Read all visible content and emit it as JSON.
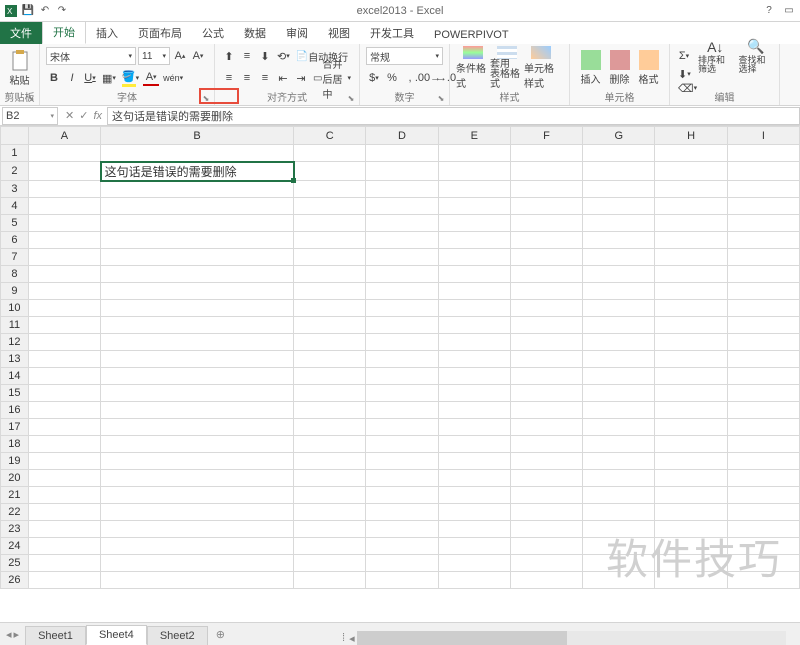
{
  "title": "excel2013 - Excel",
  "tabs": {
    "file": "文件",
    "home": "开始",
    "insert": "插入",
    "layout": "页面布局",
    "formulas": "公式",
    "data": "数据",
    "review": "审阅",
    "view": "视图",
    "dev": "开发工具",
    "pp": "POWERPIVOT"
  },
  "ribbon": {
    "clipboard": {
      "paste": "粘贴",
      "label": "剪贴板"
    },
    "font": {
      "name": "宋体",
      "size": "11",
      "label": "字体",
      "bold": "B",
      "italic": "I",
      "underline": "U"
    },
    "align": {
      "wrap": "自动换行",
      "merge": "合并后居中",
      "label": "对齐方式"
    },
    "number": {
      "general": "常规",
      "label": "数字"
    },
    "styles": {
      "cond": "条件格式",
      "table": "套用\n表格格式",
      "cell": "单元格样式",
      "label": "样式"
    },
    "cells": {
      "insert": "插入",
      "delete": "删除",
      "format": "格式",
      "label": "单元格"
    },
    "editing": {
      "sort": "排序和筛选",
      "find": "查找和选择",
      "label": "编辑"
    }
  },
  "namebox": "B2",
  "formula": "这句话是错误的需要删除",
  "columns": [
    "A",
    "B",
    "C",
    "D",
    "E",
    "F",
    "G",
    "H",
    "I"
  ],
  "rows": [
    "1",
    "2",
    "3",
    "4",
    "5",
    "6",
    "7",
    "8",
    "9",
    "10",
    "11",
    "12",
    "13",
    "14",
    "15",
    "16",
    "17",
    "18",
    "19",
    "20",
    "21",
    "22",
    "23",
    "24",
    "25",
    "26"
  ],
  "cellB2": "这句话是错误的需要删除",
  "sheets": {
    "s1": "Sheet1",
    "s4": "Sheet4",
    "s2": "Sheet2"
  },
  "watermark": "软件技巧"
}
